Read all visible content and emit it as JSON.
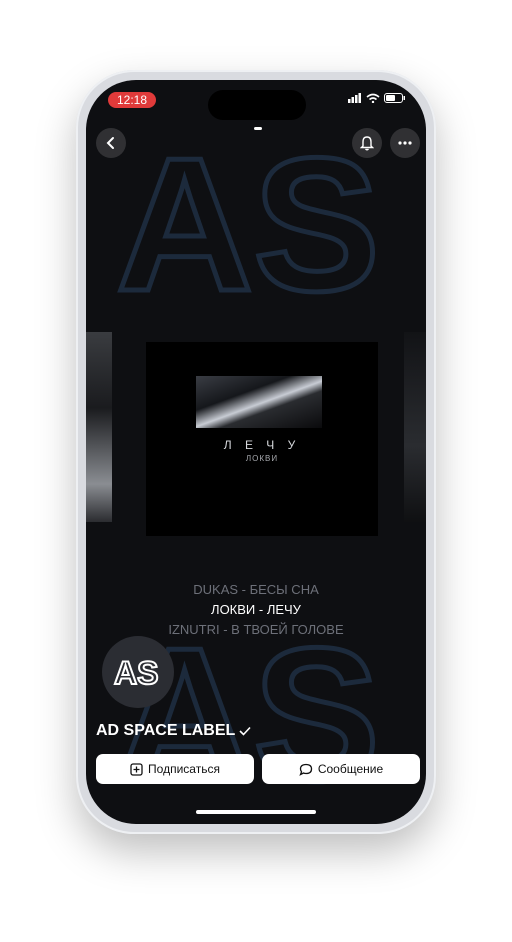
{
  "status_bar": {
    "time": "12:18"
  },
  "cover": {
    "title": "Л Е Ч У",
    "artist": "ЛОКВИ"
  },
  "tracks": [
    {
      "label": "DUKAS - БЕСЫ СНА",
      "active": false
    },
    {
      "label": "ЛОКВИ - ЛЕЧУ",
      "active": true
    },
    {
      "label": "IZNUTRI - В ТВОЕЙ ГОЛОВЕ",
      "active": false
    }
  ],
  "profile": {
    "avatar_text": "AS",
    "name": "AD SPACE LABEL",
    "verified": true
  },
  "actions": {
    "subscribe_label": "Подписаться",
    "message_label": "Сообщение"
  },
  "background": {
    "watermark_text": "AS"
  },
  "icons": {
    "back": "chevron-left-icon",
    "bell": "bell-icon",
    "more": "more-icon",
    "subscribe": "plus-square-icon",
    "message": "chat-bubble-icon",
    "verified": "check-icon"
  },
  "colors": {
    "screen_bg": "#0e0f12",
    "status_time_bg": "#e03a3a",
    "track_inactive": "#6d7079",
    "track_active": "#ffffff",
    "button_bg": "#ffffff"
  }
}
